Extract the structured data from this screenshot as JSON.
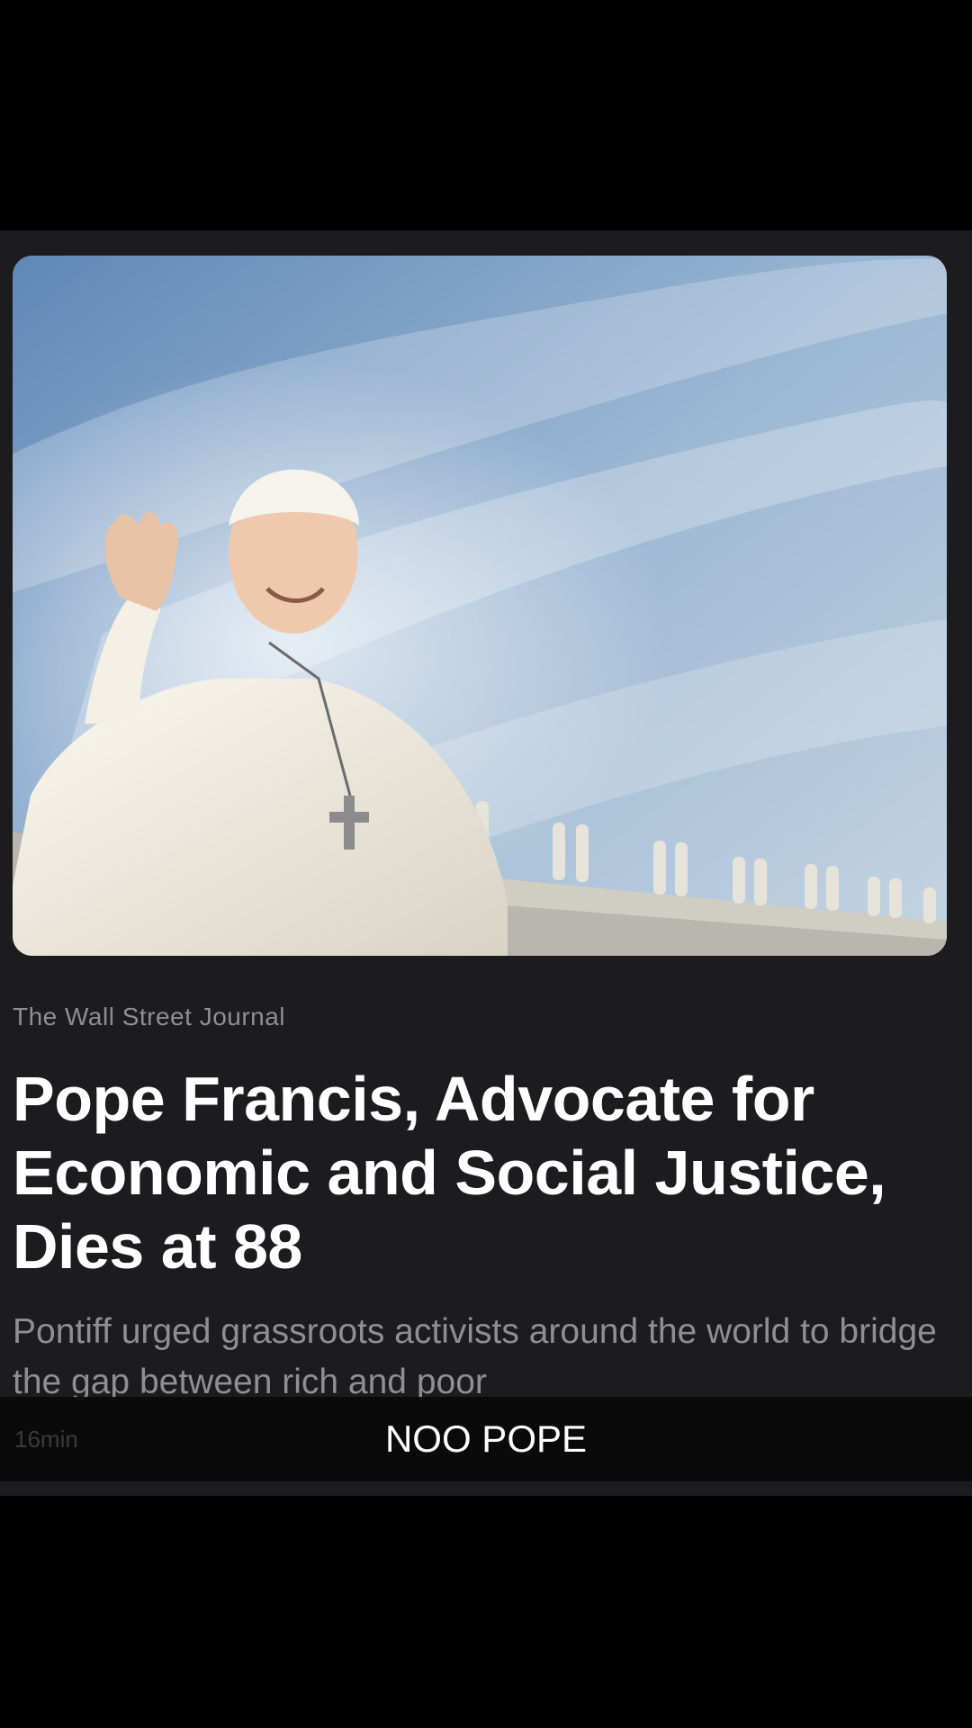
{
  "article": {
    "source": "The Wall Street Journal",
    "headline": "Pope Francis, Advocate for Economic and Social Justice, Dies at 88",
    "summary": "Pontiff urged grassroots activists around the world to bridge the gap between rich and poor",
    "time": "16min",
    "image_icon": "news-photo"
  },
  "caption": {
    "text": "NOO POPE"
  },
  "colors": {
    "background": "#000000",
    "card": "#1c1c1e",
    "secondary_text": "#8e8e93",
    "primary_text": "#ffffff"
  }
}
